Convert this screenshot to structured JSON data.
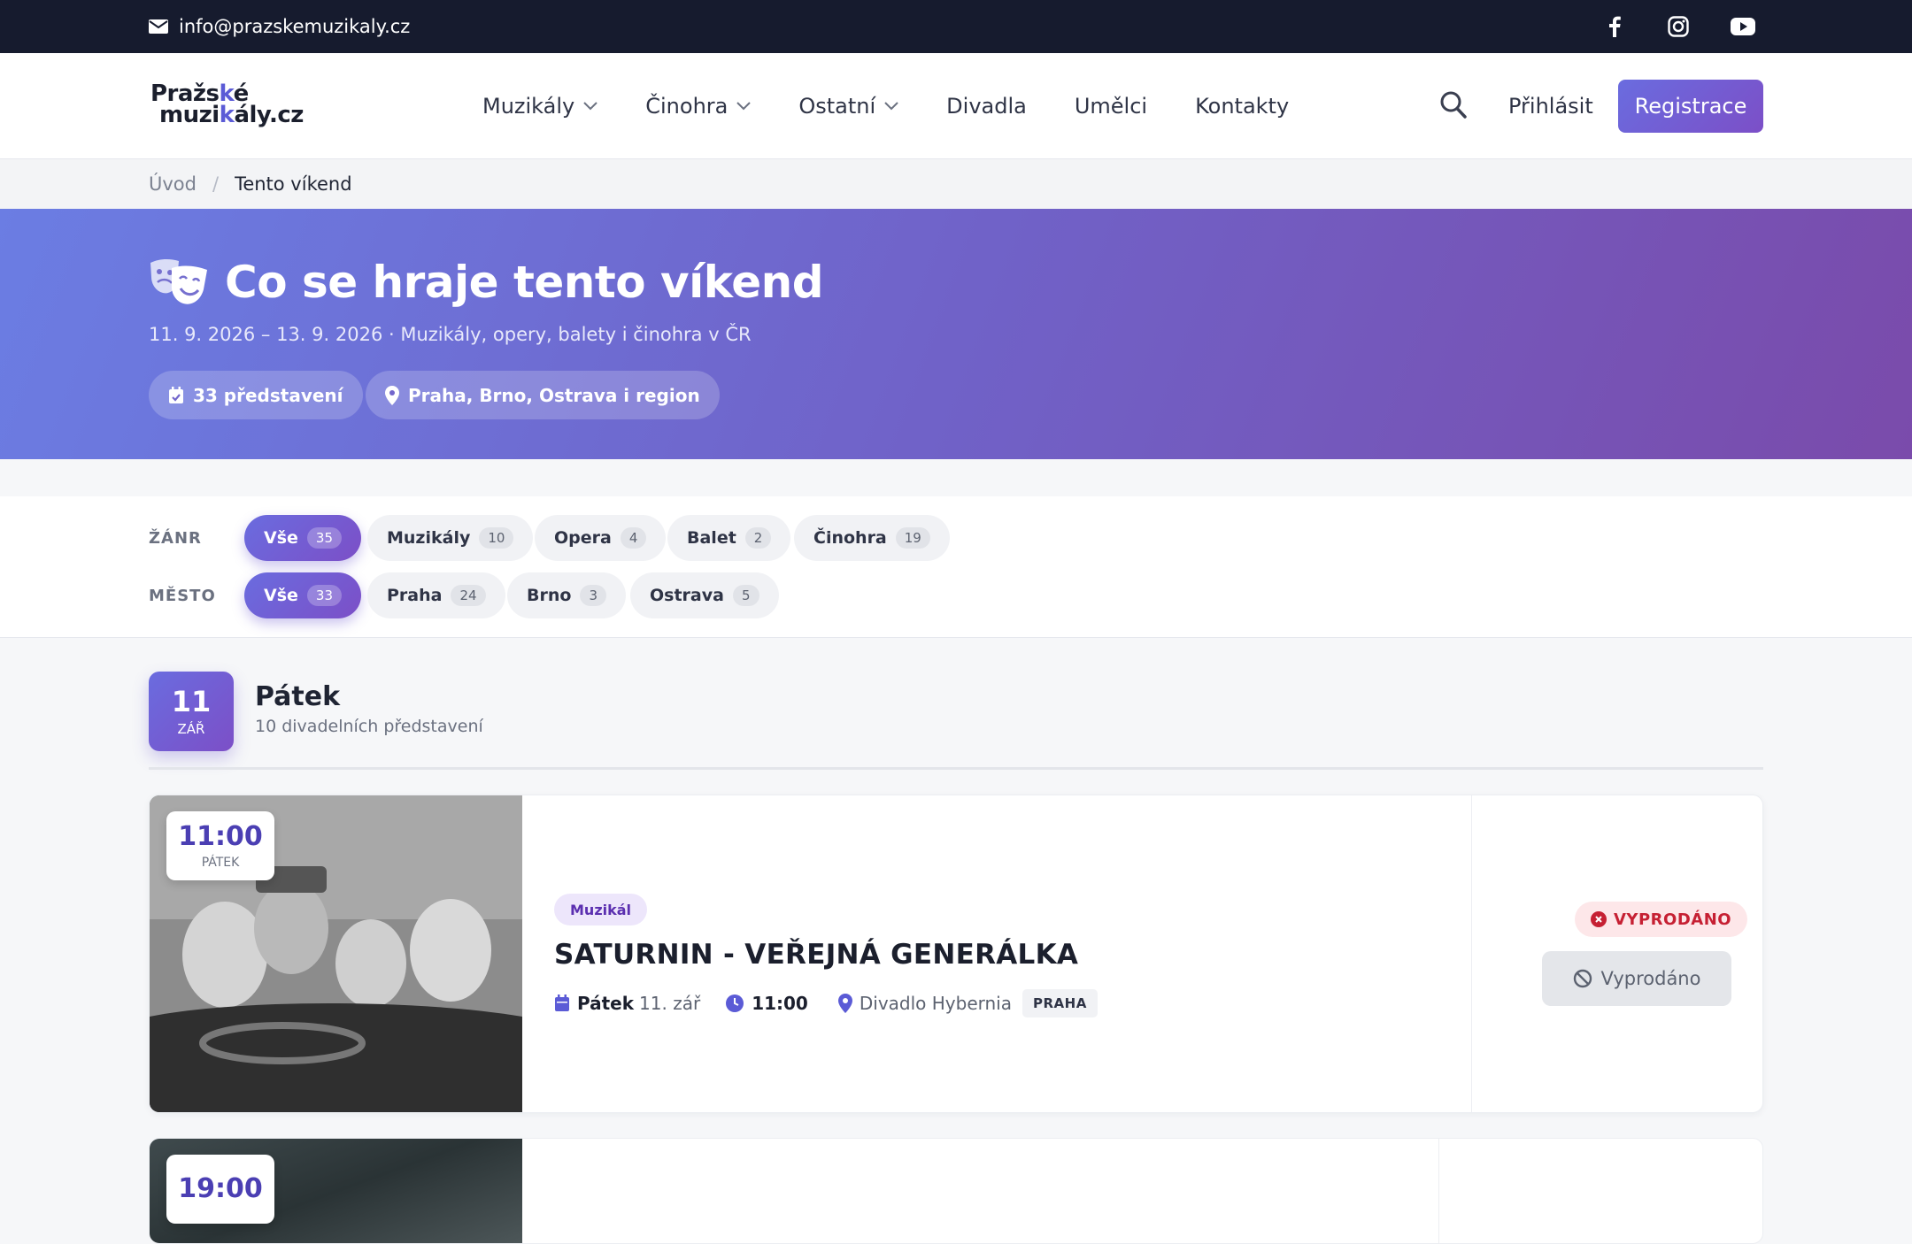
{
  "topbar": {
    "email": "info@prazskemuzikaly.cz",
    "social": [
      "facebook-icon",
      "instagram-icon",
      "youtube-icon"
    ]
  },
  "header": {
    "logo_line1_a": "Pražs",
    "logo_line1_b": "k",
    "logo_line1_c": "é",
    "logo_line2_a": "muzi",
    "logo_line2_b": "k",
    "logo_line2_c": "ály.cz",
    "nav": [
      {
        "label": "Muzikály",
        "dropdown": true
      },
      {
        "label": "Činohra",
        "dropdown": true
      },
      {
        "label": "Ostatní",
        "dropdown": true
      },
      {
        "label": "Divadla",
        "dropdown": false
      },
      {
        "label": "Umělci",
        "dropdown": false
      },
      {
        "label": "Kontakty",
        "dropdown": false
      }
    ],
    "login": "Přihlásit",
    "register": "Registrace"
  },
  "breadcrumb": {
    "home": "Úvod",
    "separator": "/",
    "current": "Tento víkend"
  },
  "hero": {
    "title": "Co se hraje tento víkend",
    "subtitle": "11. 9. 2026 – 13. 9. 2026 · Muzikály, opery, balety i činohra v ČR",
    "pill_count": "33 představení",
    "pill_region": "Praha, Brno, Ostrava i region"
  },
  "filters": {
    "genre_label": "ŽÁNR",
    "genres": [
      {
        "label": "Vše",
        "count": "35",
        "active": true
      },
      {
        "label": "Muzikály",
        "count": "10",
        "active": false
      },
      {
        "label": "Opera",
        "count": "4",
        "active": false
      },
      {
        "label": "Balet",
        "count": "2",
        "active": false
      },
      {
        "label": "Činohra",
        "count": "19",
        "active": false
      }
    ],
    "city_label": "MĚSTO",
    "cities": [
      {
        "label": "Vše",
        "count": "33",
        "active": true
      },
      {
        "label": "Praha",
        "count": "24",
        "active": false
      },
      {
        "label": "Brno",
        "count": "3",
        "active": false
      },
      {
        "label": "Ostrava",
        "count": "5",
        "active": false
      }
    ]
  },
  "day": {
    "number": "11",
    "month": "ZÁŘ",
    "title": "Pátek",
    "subtitle": "10 divadelních představení"
  },
  "events": [
    {
      "time": "11:00",
      "weekday": "PÁTEK",
      "tag": "Muzikál",
      "title": "SATURNIN - VEŘEJNÁ GENERÁLKA",
      "date_day": "Pátek",
      "date_rest": "11. zář",
      "time_meta": "11:00",
      "venue": "Divadlo Hybernia",
      "city": "PRAHA",
      "status": "VYPRODÁNO",
      "button": "Vyprodáno"
    },
    {
      "time": "19:00"
    }
  ],
  "colors": {
    "accent": "#6a6cdf",
    "accent_dark": "#7c4fc7",
    "topbar": "#161b2e",
    "sold_red": "#c62033"
  }
}
